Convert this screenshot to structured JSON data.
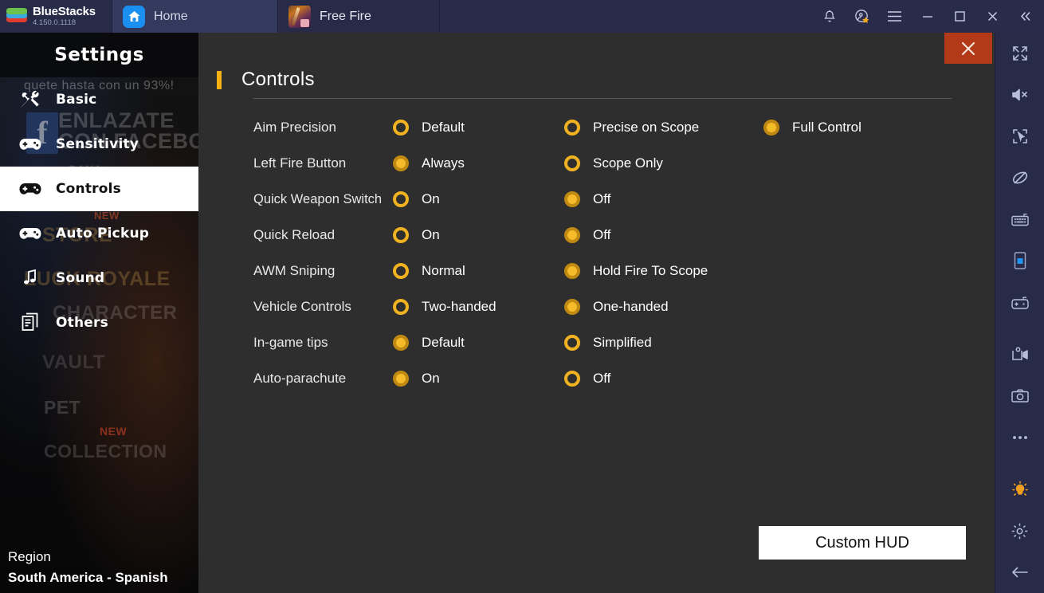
{
  "topbar": {
    "brand_name": "BlueStacks",
    "brand_version": "4.150.0.1118",
    "tabs": [
      {
        "label": "Home",
        "icon": "home-icon",
        "active": false
      },
      {
        "label": "Free Fire",
        "icon": "free-fire-app-icon",
        "active": true
      }
    ],
    "actions": [
      {
        "name": "notifications-bell-icon"
      },
      {
        "name": "rewards-star-icon"
      },
      {
        "name": "hamburger-menu-icon"
      },
      {
        "name": "minimize-icon"
      },
      {
        "name": "maximize-icon"
      },
      {
        "name": "close-window-icon"
      },
      {
        "name": "collapse-toolbar-icon"
      }
    ]
  },
  "right_toolbar": {
    "items": [
      {
        "name": "fullscreen-icon"
      },
      {
        "name": "mute-icon"
      },
      {
        "name": "select-region-icon"
      },
      {
        "name": "rotate-lock-icon"
      },
      {
        "name": "keyboard-controls-icon"
      },
      {
        "name": "portrait-mode-icon"
      },
      {
        "name": "gamepad-controls-icon"
      },
      {
        "name": "screen-record-icon"
      },
      {
        "name": "screenshot-camera-icon"
      },
      {
        "name": "more-options-icon"
      },
      {
        "name": "tips-bulb-icon"
      },
      {
        "name": "settings-gear-icon"
      },
      {
        "name": "back-arrow-icon"
      }
    ]
  },
  "settings_menu": {
    "title": "Settings",
    "items": [
      {
        "label": "Basic",
        "icon": "tools-icon",
        "active": false
      },
      {
        "label": "Sensitivity",
        "icon": "gamepad-icon",
        "active": false
      },
      {
        "label": "Controls",
        "icon": "gamepad-icon",
        "active": true
      },
      {
        "label": "Auto Pickup",
        "icon": "gamepad-icon",
        "active": false
      },
      {
        "label": "Sound",
        "icon": "music-icon",
        "active": false
      },
      {
        "label": "Others",
        "icon": "document-icon",
        "active": false
      }
    ],
    "region_label": "Region",
    "region_value": "South America - Spanish",
    "background_text": {
      "promo": "quete hasta con un 93%!",
      "fb_line1": "ENLAZATE",
      "fb_line2": "CON FACEBOOK",
      "gana": "GANA",
      "store": "STORE",
      "luck_royale": "LUCK ROYALE",
      "character": "CHARACTER",
      "vault": "VAULT",
      "pet": "PET",
      "collection": "COLLECTION",
      "new_badge_1": "NEW",
      "new_badge_2": "NEW",
      "facebook_glyph": "f"
    }
  },
  "panel": {
    "title": "Controls",
    "close_label": "×",
    "accent_color": "#f5b014",
    "selected_color": "#f5bb2a",
    "custom_hud_label": "Custom HUD",
    "rows": [
      {
        "label": "Aim Precision",
        "options": [
          {
            "label": "Default",
            "selected": false
          },
          {
            "label": "Precise on Scope",
            "selected": false
          },
          {
            "label": "Full Control",
            "selected": true
          }
        ]
      },
      {
        "label": "Left Fire Button",
        "options": [
          {
            "label": "Always",
            "selected": true
          },
          {
            "label": "Scope Only",
            "selected": false
          }
        ]
      },
      {
        "label": "Quick Weapon Switch",
        "options": [
          {
            "label": "On",
            "selected": false
          },
          {
            "label": "Off",
            "selected": true
          }
        ]
      },
      {
        "label": "Quick Reload",
        "options": [
          {
            "label": "On",
            "selected": false
          },
          {
            "label": "Off",
            "selected": true
          }
        ]
      },
      {
        "label": "AWM Sniping",
        "options": [
          {
            "label": "Normal",
            "selected": false
          },
          {
            "label": "Hold Fire To Scope",
            "selected": true
          }
        ]
      },
      {
        "label": "Vehicle Controls",
        "options": [
          {
            "label": "Two-handed",
            "selected": false
          },
          {
            "label": "One-handed",
            "selected": true
          }
        ]
      },
      {
        "label": "In-game tips",
        "options": [
          {
            "label": "Default",
            "selected": true
          },
          {
            "label": "Simplified",
            "selected": false
          }
        ]
      },
      {
        "label": "Auto-parachute",
        "options": [
          {
            "label": "On",
            "selected": true
          },
          {
            "label": "Off",
            "selected": false
          }
        ]
      }
    ]
  }
}
